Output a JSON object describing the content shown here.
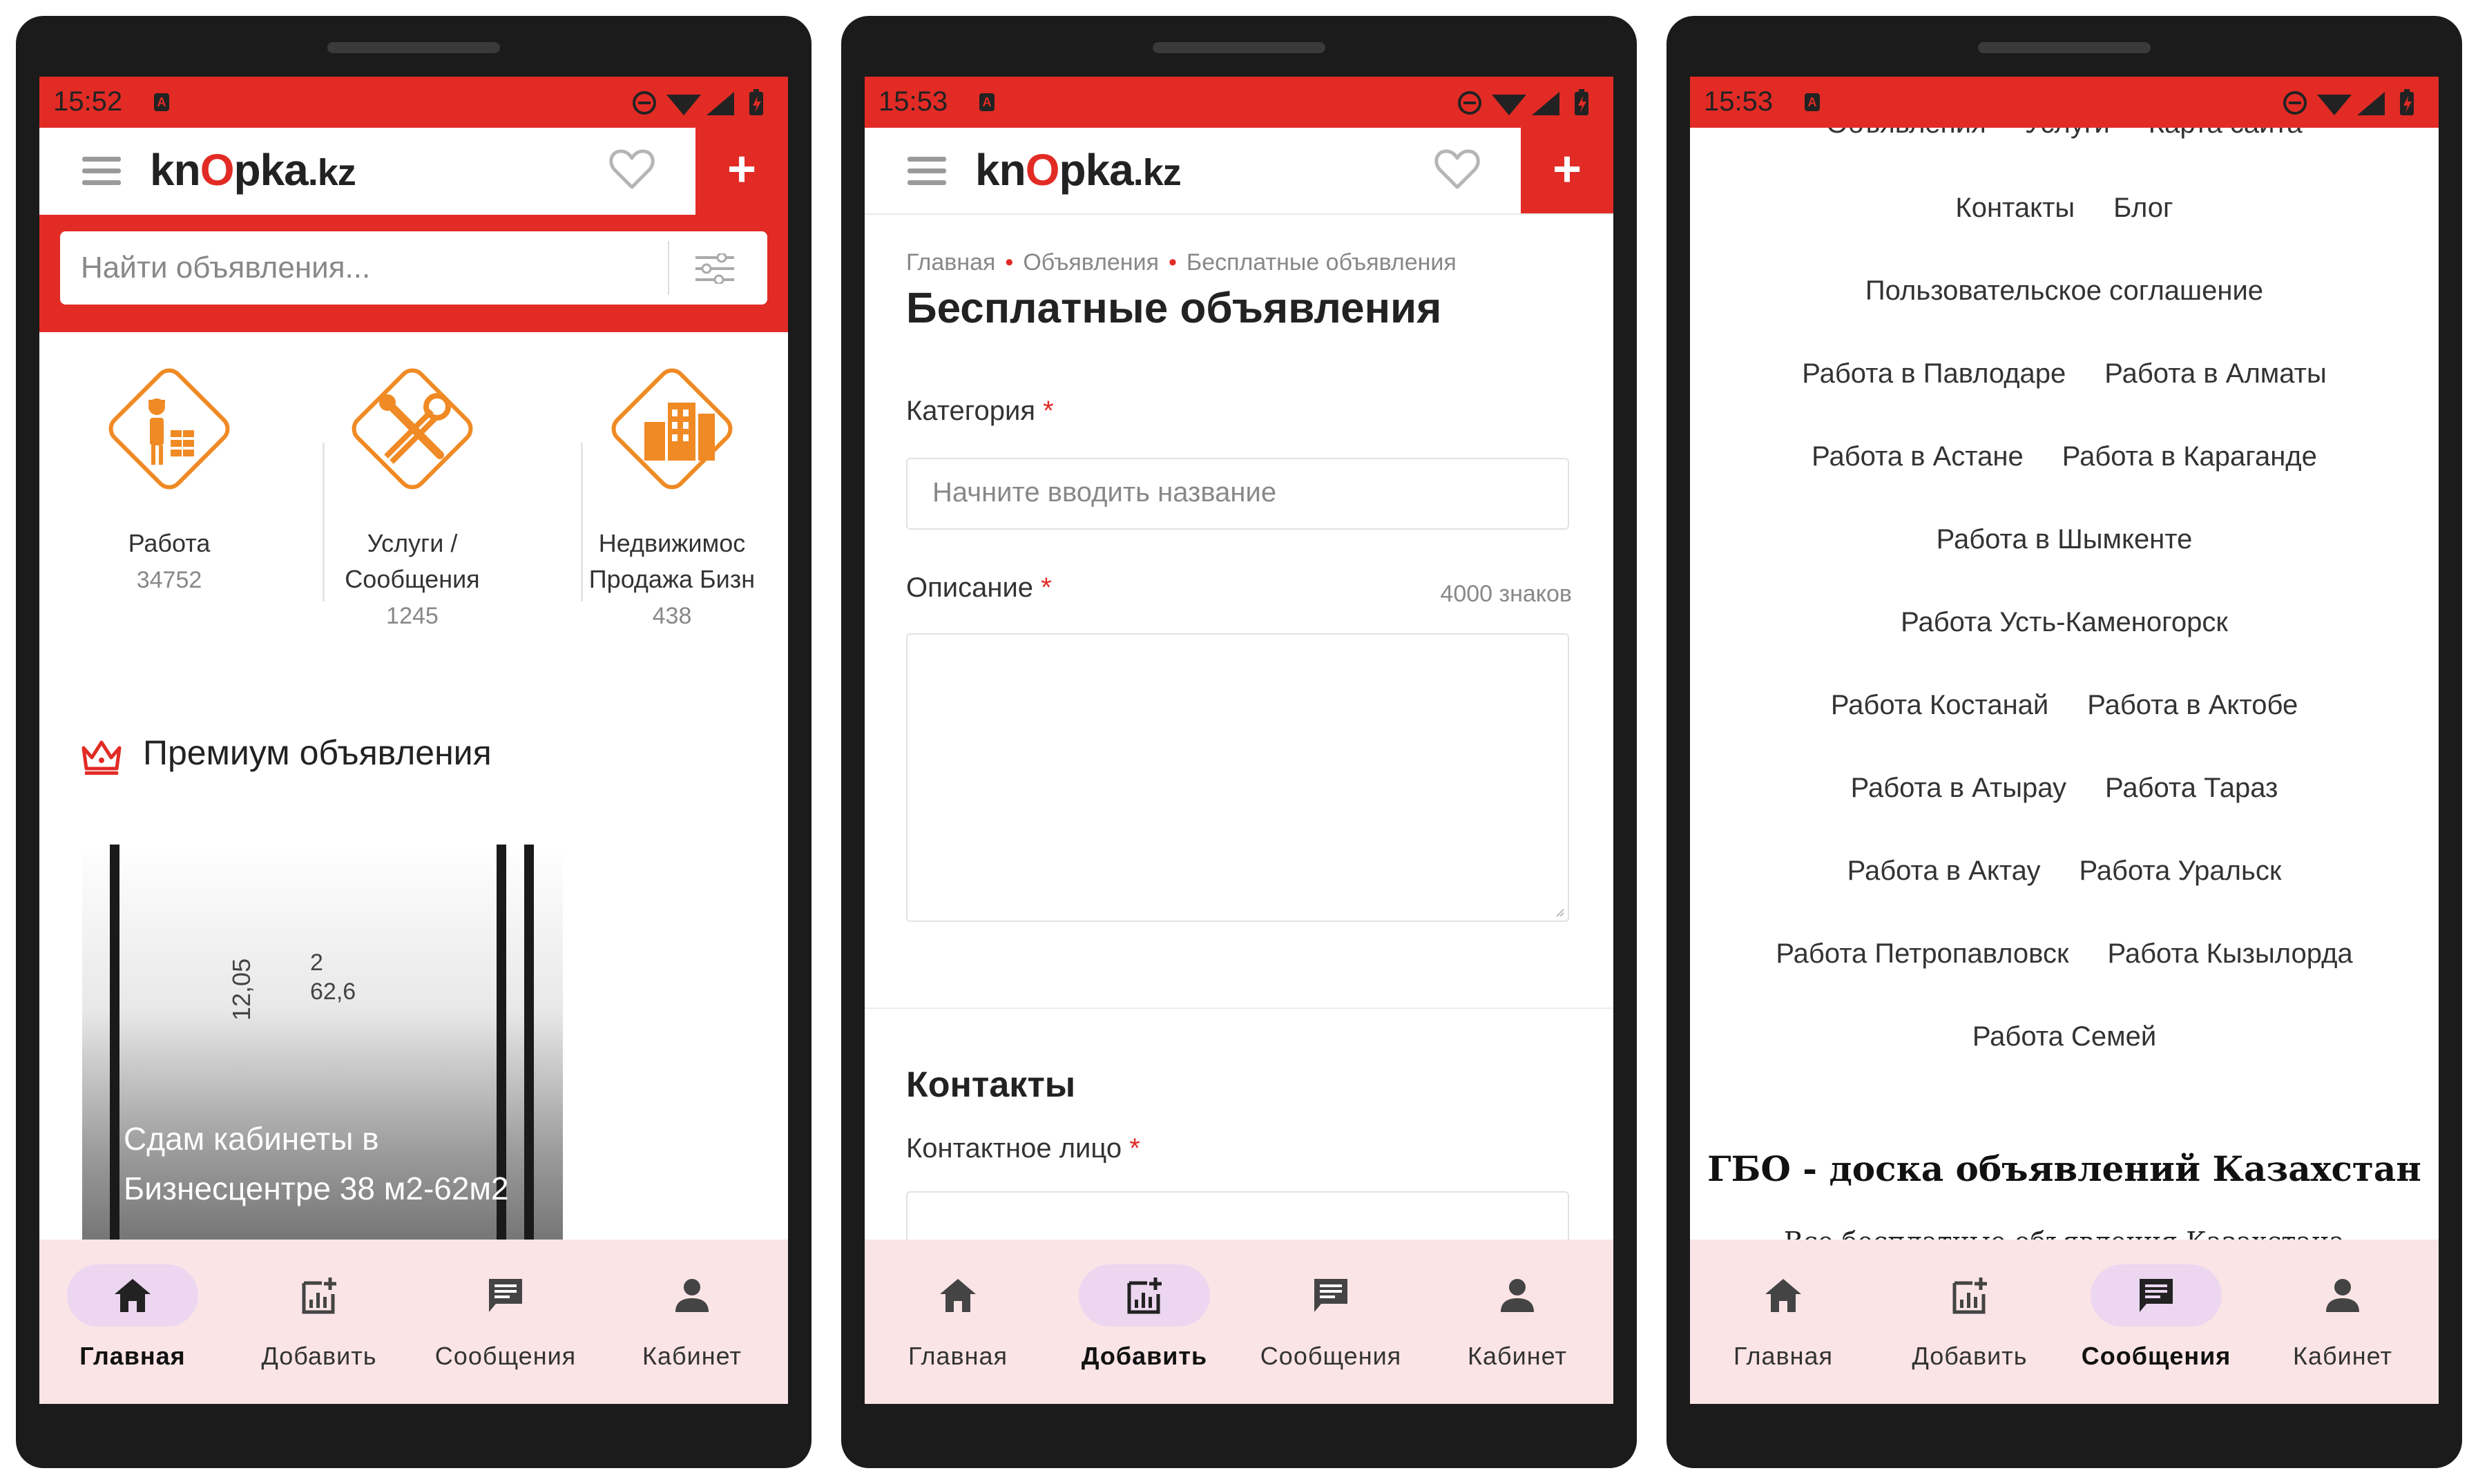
{
  "colors": {
    "brand_red": "#e22b25",
    "nav_bg": "#fbe4e6",
    "nav_active_pill": "#ecd6f0",
    "category_orange": "#f08a24"
  },
  "nav": {
    "items": [
      {
        "label": "Главная",
        "icon": "home-icon"
      },
      {
        "label": "Добавить",
        "icon": "add-chart-icon"
      },
      {
        "label": "Сообщения",
        "icon": "message-icon"
      },
      {
        "label": "Кабинет",
        "icon": "person-icon"
      }
    ]
  },
  "screens": {
    "home": {
      "time": "15:52",
      "logo": {
        "part1": "kn",
        "part2": "O",
        "part3": "pka",
        "part4": ".kz"
      },
      "add_button": "+",
      "search_placeholder": "Найти объявления...",
      "categories": [
        {
          "label_line1": "Работа",
          "label_line2": "",
          "count": "34752",
          "icon": "worker-bricks-icon"
        },
        {
          "label_line1": "Услуги /",
          "label_line2": "Сообщения",
          "count": "1245",
          "icon": "tools-icon"
        },
        {
          "label_line1": "Недвижимос",
          "label_line2": "Продажа Бизн",
          "count": "438",
          "icon": "building-icon"
        }
      ],
      "premium_title": "Премиум объявления",
      "card": {
        "image_num1": "12,05",
        "image_num2_line1": "2",
        "image_num2_line2": "62,6",
        "title": "Сдам кабинеты в Бизнесцентре 38 м2-62м2"
      },
      "active_nav": 0
    },
    "add": {
      "time": "15:53",
      "breadcrumbs": [
        "Главная",
        "Объявления",
        "Бесплатные объявления"
      ],
      "title": "Бесплатные объявления",
      "category_label": "Категория",
      "category_placeholder": "Начните вводить название",
      "description_label": "Описание",
      "description_counter": "4000 знаков",
      "contacts_title": "Контакты",
      "contact_person_label": "Контактное лицо",
      "required_mark": "*",
      "active_nav": 1
    },
    "footer": {
      "time": "15:53",
      "rows": [
        [
          "Объявления",
          "Услуги",
          "Карта сайта"
        ],
        [
          "Контакты",
          "Блог"
        ],
        [
          "Пользовательское соглашение"
        ],
        [
          "Работа в Павлодаре",
          "Работа в Алматы"
        ],
        [
          "Работа в Астане",
          "Работа в Караганде"
        ],
        [
          "Работа в Шымкенте"
        ],
        [
          "Работа Усть-Каменогорск"
        ],
        [
          "Работа Костанай",
          "Работа в Актобе"
        ],
        [
          "Работа в Атырау",
          "Работа Тараз"
        ],
        [
          "Работа в Актау",
          "Работа Уральск"
        ],
        [
          "Работа Петропавловск",
          "Работа Кызылорда"
        ],
        [
          "Работа Семей"
        ]
      ],
      "site_title": "ГБО - доска объявлений Казахстан",
      "site_subtitle": "Все бесплатные объявления Казахстана",
      "active_nav": 2
    }
  }
}
